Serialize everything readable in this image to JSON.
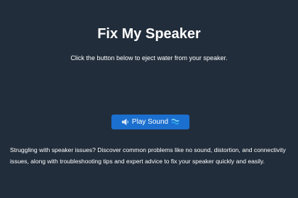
{
  "page": {
    "title": "Fix My Speaker",
    "subtitle": "Click the button below to eject water from your speaker.",
    "description": "Struggling with speaker issues? Discover common problems like no sound, distortion, and connectivity issues, along with troubleshooting tips and expert advice to fix your speaker quickly and easily."
  },
  "play_button": {
    "label": "Play Sound",
    "left_icon": "speaker-icon",
    "right_icon": "water-wave-icon"
  },
  "colors": {
    "background": "#222d3b",
    "button": "#1b6fcf",
    "text": "#ffffff"
  }
}
